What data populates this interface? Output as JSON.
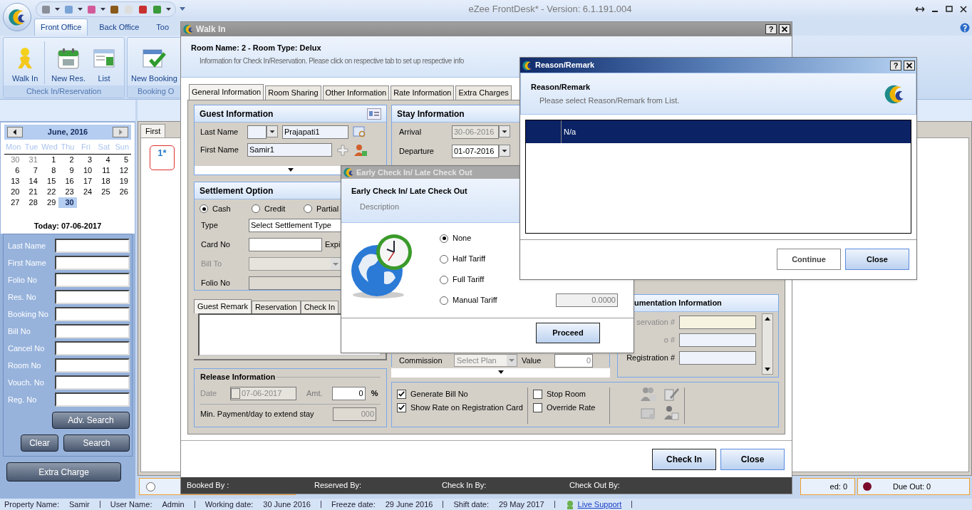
{
  "app": {
    "title": "eZee FrontDesk* - Version: 6.1.191.004"
  },
  "ribbon": {
    "tabs": [
      {
        "label": "Front Office",
        "selected": true
      },
      {
        "label": "Back Office",
        "selected": false
      },
      {
        "label": "Too",
        "selected": false
      }
    ],
    "groups": [
      {
        "label": "Check In/Reservation",
        "buttons": [
          {
            "label": "Walk In",
            "kind": "walkin"
          },
          {
            "label": "New Res.",
            "kind": "calendar"
          },
          {
            "label": "List",
            "kind": "list"
          }
        ]
      },
      {
        "label": "Booking O",
        "buttons": [
          {
            "label": "New Booking",
            "kind": "booking"
          }
        ]
      }
    ]
  },
  "calendar": {
    "month": "June, 2016",
    "weekdays": [
      "Mon",
      "Tue",
      "Wed",
      "Thu",
      "Fri",
      "Sat",
      "Sun"
    ],
    "days": [
      {
        "label": "30",
        "muted": true,
        "selected": false
      },
      {
        "label": "31",
        "muted": true,
        "selected": false
      },
      {
        "label": "1",
        "muted": false,
        "selected": false
      },
      {
        "label": "2",
        "muted": false,
        "selected": false
      },
      {
        "label": "3",
        "muted": false,
        "selected": false
      },
      {
        "label": "4",
        "muted": false,
        "selected": false
      },
      {
        "label": "5",
        "muted": false,
        "selected": false
      },
      {
        "label": "6",
        "muted": false,
        "selected": false
      },
      {
        "label": "7",
        "muted": false,
        "selected": false
      },
      {
        "label": "8",
        "muted": false,
        "selected": false
      },
      {
        "label": "9",
        "muted": false,
        "selected": false
      },
      {
        "label": "10",
        "muted": false,
        "selected": false
      },
      {
        "label": "11",
        "muted": false,
        "selected": false
      },
      {
        "label": "12",
        "muted": false,
        "selected": false
      },
      {
        "label": "13",
        "muted": false,
        "selected": false
      },
      {
        "label": "14",
        "muted": false,
        "selected": false
      },
      {
        "label": "15",
        "muted": false,
        "selected": false
      },
      {
        "label": "16",
        "muted": false,
        "selected": false
      },
      {
        "label": "17",
        "muted": false,
        "selected": false
      },
      {
        "label": "18",
        "muted": false,
        "selected": false
      },
      {
        "label": "19",
        "muted": false,
        "selected": false
      },
      {
        "label": "20",
        "muted": false,
        "selected": false
      },
      {
        "label": "21",
        "muted": false,
        "selected": false
      },
      {
        "label": "22",
        "muted": false,
        "selected": false
      },
      {
        "label": "23",
        "muted": false,
        "selected": false
      },
      {
        "label": "24",
        "muted": false,
        "selected": false
      },
      {
        "label": "25",
        "muted": false,
        "selected": false
      },
      {
        "label": "26",
        "muted": false,
        "selected": false
      },
      {
        "label": "27",
        "muted": false,
        "selected": false
      },
      {
        "label": "28",
        "muted": false,
        "selected": false
      },
      {
        "label": "29",
        "muted": false,
        "selected": false
      },
      {
        "label": "30",
        "muted": false,
        "selected": true
      }
    ],
    "today": "Today: 07-06-2017"
  },
  "search_panel": {
    "fields": [
      "Last Name",
      "First Name",
      "Folio No",
      "Res. No",
      "Booking No",
      "Bill No",
      "Cancel No",
      "Room No",
      "Vouch. No",
      "Reg. No"
    ],
    "adv_search": "Adv. Search",
    "clear": "Clear",
    "search": "Search"
  },
  "extra_charge": "Extra Charge",
  "room_view": {
    "tabs": [
      {
        "label": "First",
        "selected": true
      }
    ],
    "rooms": [
      "1*"
    ]
  },
  "legend": [
    {
      "kind": "radio"
    },
    {
      "kind": "text",
      "label": "ed: 0"
    },
    {
      "kind": "dot",
      "label": "Due Out: 0",
      "color": "#7a0a2a"
    }
  ],
  "status_bar": {
    "items": [
      {
        "label": "Property Name:",
        "value": "Samir"
      },
      {
        "label": "User Name:",
        "value": "Admin"
      },
      {
        "label": "Working date:",
        "value": "30 June 2016"
      },
      {
        "label": "Freeze date:",
        "value": "29 June 2016"
      },
      {
        "label": "Shift date:",
        "value": "29 May 2017"
      }
    ],
    "live_support": "Live Support"
  },
  "walk_in": {
    "title": "Walk In",
    "help": "?",
    "heading": "Room Name: 2 - Room Type: Delux",
    "subheading": "Information for Check In/Reservation. Please click on respective tab to set up respective info",
    "tabs": [
      {
        "label": "General Information",
        "selected": true
      },
      {
        "label": "Room Sharing",
        "selected": false
      },
      {
        "label": "Other Information",
        "selected": false
      },
      {
        "label": "Rate Information",
        "selected": false
      },
      {
        "label": "Extra Charges",
        "selected": false
      }
    ],
    "guest_information": {
      "title": "Guest Information",
      "last_name_label": "Last Name",
      "last_name": "Prajapati1",
      "first_name_label": "First Name",
      "first_name": "Samir1"
    },
    "stay_information": {
      "title": "Stay Information",
      "arrival_label": "Arrival",
      "arrival": "30-06-2016",
      "arrival_disabled": true,
      "departure_label": "Departure",
      "departure": "01-07-2016"
    },
    "settlement": {
      "title": "Settlement Option",
      "options": [
        {
          "label": "Cash",
          "selected": true
        },
        {
          "label": "Credit",
          "selected": false
        },
        {
          "label": "Partial",
          "selected": false
        }
      ],
      "type_label": "Type",
      "type_value": "Select Settlement Type",
      "card_label": "Card No",
      "expiry_label": "Expi",
      "bill_to_label": "Bill To",
      "bill_to_disabled": true,
      "folio_label": "Folio No"
    },
    "remark_tabs": [
      {
        "label": "Guest Remark",
        "selected": true
      },
      {
        "label": "Reservation",
        "selected": false
      },
      {
        "label": "Check In",
        "selected": false
      }
    ],
    "release": {
      "title": "Release Information",
      "date_label": "Date",
      "date": "07-06-2017",
      "disabled": true,
      "amount_label": "Amt.",
      "amount": "0",
      "percent": "%",
      "min_payment_label": "Min. Payment/day to extend stay",
      "min_payment": "000"
    },
    "commission": {
      "label": "Commission",
      "plan": "Select Plan",
      "value_label": "Value",
      "value": "0"
    },
    "documentation": {
      "title": "umentation Information",
      "fields": [
        "servation #",
        "o #",
        "Registration #"
      ]
    },
    "options": [
      {
        "label": "Generate Bill No",
        "checked": true
      },
      {
        "label": "Show Rate on Registration Card",
        "checked": true
      },
      {
        "label": "Stop Room",
        "checked": false
      },
      {
        "label": "Override Rate",
        "checked": false
      }
    ],
    "buttons": [
      "Check In",
      "Close"
    ],
    "footer": [
      "Booked By :",
      "Reserved By:",
      "Check In By:",
      "Check Out By:"
    ]
  },
  "early_check": {
    "title": "Early Check In/ Late Check Out",
    "heading": "Early Check In/ Late Check Out",
    "description": "Description",
    "options": [
      {
        "label": "None",
        "selected": true
      },
      {
        "label": "Half Tariff",
        "selected": false
      },
      {
        "label": "Full Tariff",
        "selected": false
      },
      {
        "label": "Manual Tariff",
        "selected": false
      }
    ],
    "manual_value": "0.0000",
    "button": "Proceed"
  },
  "reason": {
    "title": "Reason/Remark",
    "help": "?",
    "heading": "Reason/Remark",
    "description": "Please select Reason/Remark from List.",
    "rows": [
      {
        "label": "N/a",
        "selected": true
      }
    ],
    "buttons": [
      "Continue",
      "Close"
    ]
  }
}
